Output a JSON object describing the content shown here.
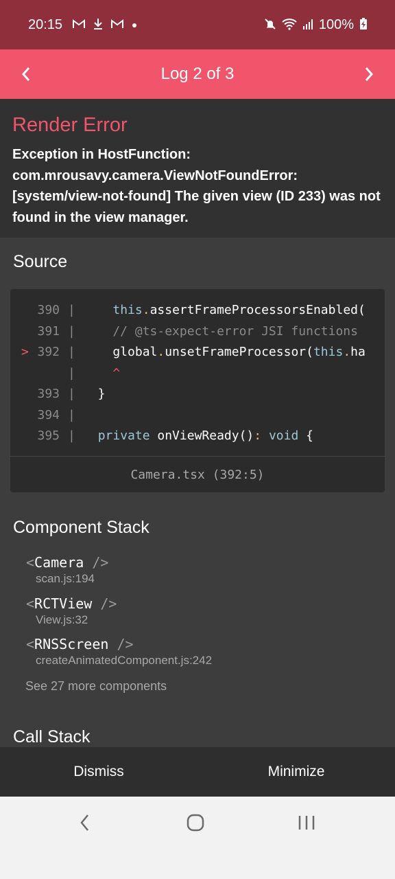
{
  "status_bar": {
    "time": "20:15",
    "battery": "100%",
    "left_icons": [
      "gmail-icon",
      "download-icon",
      "gmail-icon",
      "dot-icon"
    ],
    "right_icons": [
      "mute-icon",
      "wifi-icon",
      "signal-icon",
      "battery-charging-icon"
    ],
    "background": "#8f2f3c"
  },
  "header": {
    "title": "Log 2 of 3",
    "background": "#f0556b"
  },
  "error": {
    "title": "Render Error",
    "message": "Exception in HostFunction: com.mrousavy.camera.ViewNotFoundError: [system/view-not-found] The given view (ID 233) was not found in the view manager."
  },
  "source": {
    "heading": "Source",
    "lines": [
      {
        "num": "390",
        "marker": "",
        "code": "    this.assertFrameProcessorsEnabled("
      },
      {
        "num": "391",
        "marker": "",
        "code": "    // @ts-expect-error JSI functions"
      },
      {
        "num": "392",
        "marker": ">",
        "code": "    global.unsetFrameProcessor(this.ha"
      },
      {
        "num": "",
        "marker": "",
        "code": "    ^"
      },
      {
        "num": "393",
        "marker": "",
        "code": "  }"
      },
      {
        "num": "394",
        "marker": "",
        "code": ""
      },
      {
        "num": "395",
        "marker": "",
        "code": "  private onViewReady(): void {"
      }
    ],
    "file": "Camera.tsx (392:5)"
  },
  "component_stack": {
    "heading": "Component Stack",
    "items": [
      {
        "name": "Camera",
        "file": "scan.js:194"
      },
      {
        "name": "RCTView",
        "file": "View.js:32"
      },
      {
        "name": "RNSScreen",
        "file": "createAnimatedComponent.js:242"
      }
    ],
    "see_more": "See 27 more components"
  },
  "call_stack": {
    "heading": "Call Stack"
  },
  "actions": {
    "dismiss": "Dismiss",
    "minimize": "Minimize"
  },
  "system_nav": {
    "icons": [
      "back-icon",
      "home-icon",
      "recents-icon"
    ]
  }
}
